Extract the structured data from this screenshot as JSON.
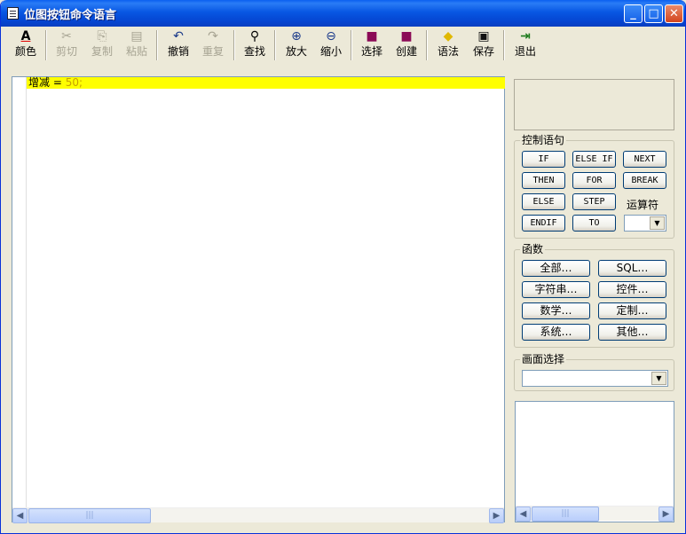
{
  "window": {
    "title": "位图按钮命令语言",
    "controls": {
      "minimize": "_",
      "maximize": "□",
      "close": "✕"
    }
  },
  "toolbar": {
    "items": [
      {
        "icon": "A",
        "label": "颜色",
        "enabled": true
      },
      {
        "icon": "✂",
        "label": "剪切",
        "enabled": false
      },
      {
        "icon": "⎘",
        "label": "复制",
        "enabled": false
      },
      {
        "icon": "▤",
        "label": "粘贴",
        "enabled": false
      },
      {
        "icon": "↶",
        "label": "撤销",
        "enabled": true
      },
      {
        "icon": "↷",
        "label": "重复",
        "enabled": false
      },
      {
        "icon": "⚲",
        "label": "查找",
        "enabled": true
      },
      {
        "icon": "⊕",
        "label": "放大",
        "enabled": true
      },
      {
        "icon": "⊖",
        "label": "缩小",
        "enabled": true
      },
      {
        "icon": "■",
        "label": "选择",
        "enabled": true
      },
      {
        "icon": "■",
        "label": "创建",
        "enabled": true
      },
      {
        "icon": "◆",
        "label": "语法",
        "enabled": true
      },
      {
        "icon": "▣",
        "label": "保存",
        "enabled": true
      },
      {
        "icon": "⇥",
        "label": "退出",
        "enabled": true
      }
    ]
  },
  "editor": {
    "code": {
      "ident": "增减",
      "op": " = ",
      "num": "50",
      "end": ";"
    },
    "scroll_thumb": "|||"
  },
  "control_group": {
    "label": "控制语句",
    "buttons": [
      "IF",
      "ELSE IF",
      "NEXT",
      "THEN",
      "FOR",
      "BREAK",
      "ELSE",
      "STEP",
      "ENDIF",
      "TO"
    ],
    "operator_label": "运算符",
    "operator_value": ""
  },
  "function_group": {
    "label": "函数",
    "buttons": [
      "全部…",
      "SQL…",
      "字符串…",
      "控件…",
      "数学…",
      "定制…",
      "系统…",
      "其他…"
    ]
  },
  "screen_group": {
    "label": "画面选择",
    "value": ""
  },
  "right_list": {
    "scroll_thumb": "|||"
  },
  "colors": {
    "title_bar": "#0a5ff0",
    "highlight_line": "#ffff00",
    "number": "#c8a000",
    "window_bg": "#ece9d8"
  }
}
